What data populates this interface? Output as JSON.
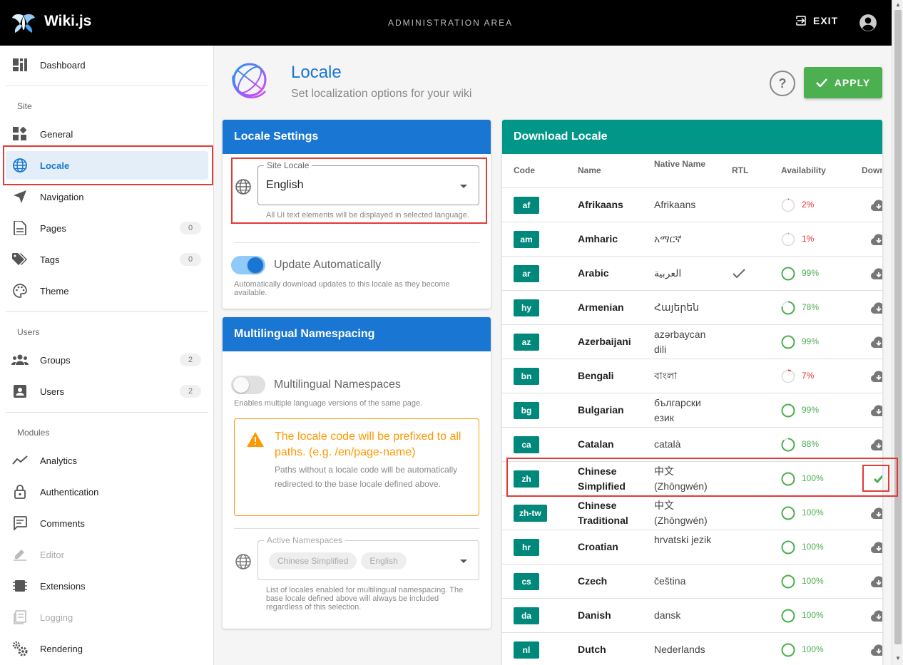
{
  "topbar": {
    "brand": "Wiki.js",
    "title": "ADMINISTRATION AREA",
    "exit_label": "EXIT"
  },
  "sidebar": {
    "dashboard": "Dashboard",
    "site_header": "Site",
    "general": "General",
    "locale": "Locale",
    "navigation": "Navigation",
    "pages": "Pages",
    "pages_count": "0",
    "tags": "Tags",
    "tags_count": "0",
    "theme": "Theme",
    "users_header": "Users",
    "groups": "Groups",
    "groups_count": "2",
    "users": "Users",
    "users_count": "2",
    "modules_header": "Modules",
    "analytics": "Analytics",
    "authentication": "Authentication",
    "comments": "Comments",
    "editor": "Editor",
    "extensions": "Extensions",
    "logging": "Logging",
    "rendering": "Rendering"
  },
  "header": {
    "title": "Locale",
    "subtitle": "Set localization options for your wiki",
    "help": "?",
    "apply_label": "APPLY"
  },
  "locale_settings": {
    "title": "Locale Settings",
    "site_locale_label": "Site Locale",
    "site_locale_value": "English",
    "site_locale_hint": "All UI text elements will be displayed in selected language.",
    "update_label": "Update Automatically",
    "update_hint": "Automatically download updates to this locale as they become available."
  },
  "namespacing": {
    "title": "Multilingual Namespacing",
    "toggle_label": "Multilingual Namespaces",
    "toggle_hint": "Enables multiple language versions of the same page.",
    "warning_title": "The locale code will be prefixed to all paths. (e.g. /en/page-name)",
    "warning_text": "Paths without a locale code will be automatically redirected to the base locale defined above.",
    "active_label": "Active Namespaces",
    "chips": [
      "Chinese Simplified",
      "English"
    ],
    "active_hint": "List of locales enabled for multilingual namespacing. The base locale defined above will always be included regardless of this selection."
  },
  "download": {
    "title": "Download Locale",
    "headers": {
      "code": "Code",
      "name": "Name",
      "native": "Native Name",
      "rtl": "RTL",
      "availability": "Availability",
      "download": "Down"
    },
    "rows": [
      {
        "code": "af",
        "name": "Afrikaans",
        "native": "Afrikaans",
        "rtl": false,
        "availability": "2%",
        "pct": 2,
        "installed": false
      },
      {
        "code": "am",
        "name": "Amharic",
        "native": "አማርኛ",
        "rtl": false,
        "availability": "1%",
        "pct": 1,
        "installed": false
      },
      {
        "code": "ar",
        "name": "Arabic",
        "native": "العربية",
        "rtl": true,
        "availability": "99%",
        "pct": 99,
        "installed": false
      },
      {
        "code": "hy",
        "name": "Armenian",
        "native": "Հայերեն",
        "rtl": false,
        "availability": "78%",
        "pct": 78,
        "installed": false
      },
      {
        "code": "az",
        "name": "Azerbaijani",
        "native": "azərbaycan dili",
        "rtl": false,
        "availability": "99%",
        "pct": 99,
        "installed": false
      },
      {
        "code": "bn",
        "name": "Bengali",
        "native": "বাংলা",
        "rtl": false,
        "availability": "7%",
        "pct": 7,
        "installed": false
      },
      {
        "code": "bg",
        "name": "Bulgarian",
        "native": "български език",
        "rtl": false,
        "availability": "99%",
        "pct": 99,
        "installed": false
      },
      {
        "code": "ca",
        "name": "Catalan",
        "native": "català",
        "rtl": false,
        "availability": "88%",
        "pct": 88,
        "installed": false
      },
      {
        "code": "zh",
        "name": "Chinese Simplified",
        "native": "中文 (Zhōngwén)",
        "rtl": false,
        "availability": "100%",
        "pct": 100,
        "installed": true
      },
      {
        "code": "zh-tw",
        "name": "Chinese Traditional",
        "native": "中文 (Zhōngwén)",
        "rtl": false,
        "availability": "100%",
        "pct": 100,
        "installed": false
      },
      {
        "code": "hr",
        "name": "Croatian",
        "native": "hrvatski jezik",
        "rtl": false,
        "availability": "100%",
        "pct": 100,
        "installed": false
      },
      {
        "code": "cs",
        "name": "Czech",
        "native": "čeština",
        "rtl": false,
        "availability": "100%",
        "pct": 100,
        "installed": false
      },
      {
        "code": "da",
        "name": "Danish",
        "native": "dansk",
        "rtl": false,
        "availability": "100%",
        "pct": 100,
        "installed": false
      },
      {
        "code": "nl",
        "name": "Dutch",
        "native": "Nederlands",
        "rtl": false,
        "availability": "100%",
        "pct": 100,
        "installed": false
      }
    ]
  },
  "colors": {
    "primary": "#1976d2",
    "teal": "#009688",
    "success": "#4caf50",
    "warning": "#ff9800",
    "danger": "#e53935",
    "highlight": "#e53935"
  }
}
